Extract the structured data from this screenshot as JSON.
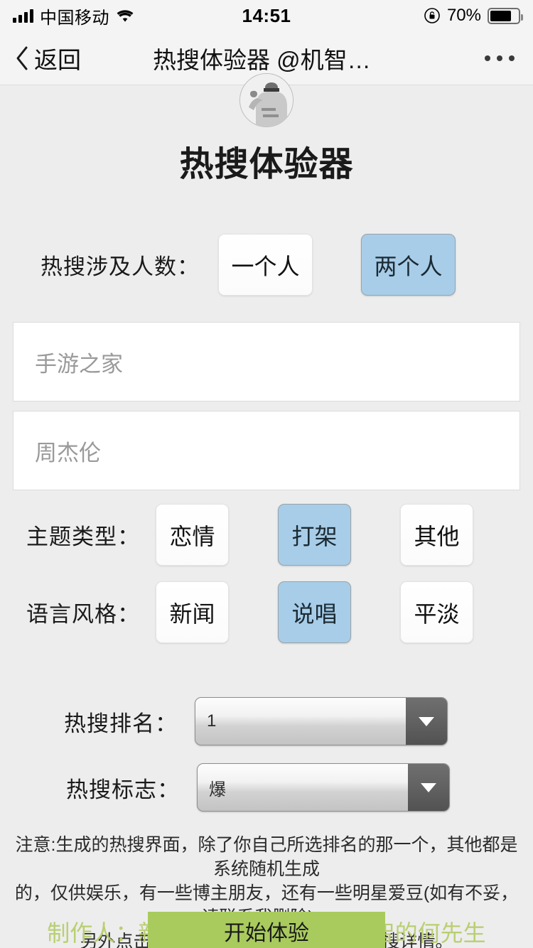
{
  "statusbar": {
    "carrier": "中国移动",
    "time": "14:51",
    "battery_percent": "70%",
    "signal_icon": "signal-bars-icon",
    "wifi_icon": "wifi-icon",
    "lock_icon": "rotation-lock-icon",
    "battery_icon": "battery-icon"
  },
  "navbar": {
    "back_label": "返回",
    "back_icon": "chevron-left-icon",
    "title": "热搜体验器 @机智的何...",
    "more_icon": "more-dots-icon"
  },
  "header": {
    "avatar_icon": "user-avatar-photo",
    "app_title": "热搜体验器"
  },
  "people": {
    "label": "热搜涉及人数：",
    "options": [
      {
        "label": "一个人",
        "selected": false
      },
      {
        "label": "两个人",
        "selected": true
      }
    ]
  },
  "inputs": [
    {
      "name": "name-field-1",
      "value": "",
      "placeholder": "手游之家"
    },
    {
      "name": "name-field-2",
      "value": "",
      "placeholder": "周杰伦"
    }
  ],
  "theme": {
    "label": "主题类型：",
    "options": [
      {
        "label": "恋情",
        "selected": false
      },
      {
        "label": "打架",
        "selected": true
      },
      {
        "label": "其他",
        "selected": false
      }
    ]
  },
  "style": {
    "label": "语言风格：",
    "options": [
      {
        "label": "新闻",
        "selected": false
      },
      {
        "label": "说唱",
        "selected": true
      },
      {
        "label": "平淡",
        "selected": false
      }
    ]
  },
  "rank": {
    "label": "热搜排名：",
    "value": "1",
    "arrow_icon": "chevron-down-icon"
  },
  "flag": {
    "label": "热搜标志：",
    "value": "爆",
    "arrow_icon": "chevron-down-icon"
  },
  "notice": {
    "line1": "注意:生成的热搜界面，除了你自己所选排名的那一个，其他都是系统随机生成",
    "line2": "的，仅供娱乐，有一些博主朋友，还有一些明星爱豆(如有不妥，请联系我删除)。",
    "line3": "另外点击你所生成的那一栏，可体验热搜详情。"
  },
  "footer": {
    "credit": "制作人：新浪微博最帅博主 @机智的何先生",
    "start_label": "开始体验"
  },
  "colors": {
    "page_background": "#ededed",
    "bar_background": "#f4f4f4",
    "selected_button": "#a8cde8",
    "start_button": "#a9cb5e",
    "credit_text": "#b9cf72",
    "placeholder_text": "#9a9a9a"
  }
}
